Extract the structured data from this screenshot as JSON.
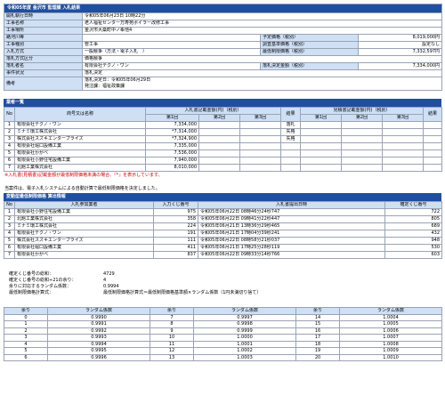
{
  "header": {
    "title": "令和05年度 金沢市 監理課 入札結果"
  },
  "info": {
    "rows": [
      {
        "label": "開札執行日時",
        "value": "令和05年06月23日 10時22分"
      },
      {
        "label": "工事名称",
        "value": "老人福祉センター万寿苑ボイラー改修工事"
      },
      {
        "label": "工事場所",
        "value": "金沢市大桑町中ノ峯他4"
      }
    ],
    "contract_label": "路河川等",
    "contract_value": "",
    "planned_label": "予定価格（税別）",
    "planned_value": "8,019,000円",
    "type_label": "工事種別",
    "type_value": "管工事",
    "survey_label": "調査基準価格（税別）",
    "survey_value": "設定なし",
    "method_label": "入札方式",
    "method_value": "一般競争（方法・電子入札　）",
    "min_label": "最低制限価格（税別）",
    "min_value": "7,332,597円",
    "decide_label": "落札方式区分",
    "decide_value": "価格競争",
    "winner_label": "落札者名",
    "winner_value": "有限会社テクノ・ワン",
    "winner_price_label": "落札決定金額（税別）",
    "winner_price_value": "7,334,000円",
    "status_label": "事件状況",
    "status_value": "落札決定",
    "remarks_label": "備考",
    "remarks_1": "落札決定日：令和05年06月29日",
    "remarks_2": "発注課：福祉政策課"
  },
  "bidders": {
    "section_title": "業者一覧",
    "h_no": "No",
    "h_name": "商号又は名称",
    "h_bid": "入札書記載金額(円)（税別）",
    "h_result": "結果",
    "h_sub": "見積書記載金額(円)（税別）",
    "h_sub_result": "結果",
    "h_r1": "第1回",
    "h_r2": "第2回",
    "h_r3": "第3回",
    "h_s1": "第1回",
    "h_s2": "第2回",
    "h_s3": "第3回",
    "rows": [
      {
        "no": "1",
        "name": "有限会社テクノ・ワン",
        "r1": "7,334,000",
        "result": "落札"
      },
      {
        "no": "2",
        "name": "ミナミ環工株式会社",
        "r1": "*7,314,000",
        "result": "失格"
      },
      {
        "no": "3",
        "name": "株式会社スズキエンタープライズ",
        "r1": "*7,324,900",
        "result": "失格"
      },
      {
        "no": "4",
        "name": "有限会社堀口設備工業",
        "r1": "7,335,000",
        "result": ""
      },
      {
        "no": "5",
        "name": "有限会社かがべ",
        "r1": "7,536,000",
        "result": ""
      },
      {
        "no": "6",
        "name": "有限会社小野住宅設備工業",
        "r1": "7,940,000",
        "result": ""
      },
      {
        "no": "7",
        "name": "北館工業株式会社",
        "r1": "8,010,000",
        "result": ""
      }
    ],
    "note": "※入札書(見積書)記載金額が最低制限価格未満の場合、『*』を表示しています。"
  },
  "lottery_notice": "当案件は、電子入札システムによる自動計算で最低制限価格を決定しました。",
  "lottery": {
    "section_title": "変動型最低制限価格 算出情報",
    "h_no": "No",
    "h_name": "入札参加業者",
    "h_num": "入力くじ番号",
    "h_date": "入札書提出日時",
    "h_lot": "確定くじ番号",
    "rows": [
      {
        "no": "1",
        "name": "有限会社小野住宅設備工業",
        "num": "975",
        "date": "令和05年06月22日 08時46分24秒747",
        "lot": "722"
      },
      {
        "no": "2",
        "name": "北館工業株式会社",
        "num": "358",
        "date": "令和05年06月22日 09時41分22秒447",
        "lot": "805"
      },
      {
        "no": "3",
        "name": "ミナミ環工株式会社",
        "num": "224",
        "date": "令和05年06月21日 13時36分29秒465",
        "lot": "689"
      },
      {
        "no": "4",
        "name": "有限会社テクノ・ワン",
        "num": "191",
        "date": "令和05年06月21日 17時04分39秒241",
        "lot": "432"
      },
      {
        "no": "5",
        "name": "株式会社スズキエンタープライズ",
        "num": "111",
        "date": "令和05年06月22日 08時58分21秒037",
        "lot": "948"
      },
      {
        "no": "6",
        "name": "有限会社堀口設備工業",
        "num": "411",
        "date": "令和05年06月21日 17時25分28秒119",
        "lot": "530"
      },
      {
        "no": "7",
        "name": "有限会社かがべ",
        "num": "837",
        "date": "令和05年06月22日 09時33分14秒766",
        "lot": "603"
      }
    ]
  },
  "calc": {
    "sum_label": "確定くじ番号の総和：",
    "sum_value": "4729",
    "rem_label": "確定くじ番号の総和÷21の余り：",
    "rem_value": "4",
    "coef_label": "余りに対応するランダム係数：",
    "coef_value": "0.9994",
    "formula_label": "最低制限価格計算式：",
    "formula_value": "最低制限価格計算式＝最低制限価格基準額×ランダム係数（1円未満切り捨て）"
  },
  "random_table": {
    "h_rem": "余り",
    "h_coef": "ランダム係数",
    "rows": [
      {
        "a": "0",
        "ac": "0.9990",
        "b": "7",
        "bc": "0.9997",
        "c": "14",
        "cc": "1.0004"
      },
      {
        "a": "1",
        "ac": "0.9991",
        "b": "8",
        "bc": "0.9998",
        "c": "15",
        "cc": "1.0005"
      },
      {
        "a": "2",
        "ac": "0.9992",
        "b": "9",
        "bc": "0.9999",
        "c": "16",
        "cc": "1.0006"
      },
      {
        "a": "3",
        "ac": "0.9993",
        "b": "10",
        "bc": "1.0000",
        "c": "17",
        "cc": "1.0007"
      },
      {
        "a": "4",
        "ac": "0.9994",
        "b": "11",
        "bc": "1.0001",
        "c": "18",
        "cc": "1.0008"
      },
      {
        "a": "5",
        "ac": "0.9995",
        "b": "12",
        "bc": "1.0002",
        "c": "19",
        "cc": "1.0009"
      },
      {
        "a": "6",
        "ac": "0.9996",
        "b": "13",
        "bc": "1.0003",
        "c": "20",
        "cc": "1.0010"
      }
    ]
  }
}
